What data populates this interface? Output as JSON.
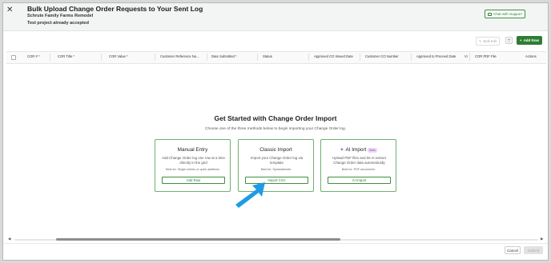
{
  "window": {
    "close_glyph": "✕",
    "title": "Bulk Upload Change Order Requests to Your Sent Log",
    "project": "Schrute Family Farms Remodel",
    "status": "Test project already accepted",
    "chat_support": "Chat with Support"
  },
  "toolbar": {
    "bulk_edit": "Bulk Edit",
    "add_row": "Add Row"
  },
  "columns": [
    "COR # *",
    "COR Title *",
    "COR Value *",
    "Customer Reference Nu...",
    "Date Submitted *",
    "Status",
    "Approved CO Issued Date",
    "Customer CO Number",
    "Approved to Proceed Date",
    "Vi",
    "COR PDF File",
    "Actions"
  ],
  "empty_state": {
    "heading": "Get Started with Change Order Import",
    "description": "Choose one of the three methods below to begin importing your Change Order log."
  },
  "cards": [
    {
      "title": "Manual Entry",
      "description": "Add Change Order log one row at a time directly in the grid",
      "best_for": "Best for: Single entries or quick additions",
      "button": "Add Row"
    },
    {
      "title": "Classic Import",
      "description": "Import your Change Order log via template",
      "best_for": "Best for: Spreadsheets",
      "button": "Import CSV"
    },
    {
      "title": "AI Import",
      "badge": "Beta",
      "description": "Upload PDF files and let AI extract Change Order data automatically",
      "best_for": "Best for: PDF documents",
      "button": "AI Import"
    }
  ],
  "footer": {
    "cancel": "Cancel",
    "submit": "Submit"
  },
  "colors": {
    "accent_green": "#2e7d32",
    "card_border": "#6fb06f",
    "pointer_arrow": "#1e9be6",
    "ai_purple": "#9c3fd1"
  },
  "icons": [
    "close-icon",
    "chat-icon",
    "edit-icon",
    "trash-icon",
    "plus-icon",
    "sparkle-icon",
    "pointer-arrow"
  ]
}
